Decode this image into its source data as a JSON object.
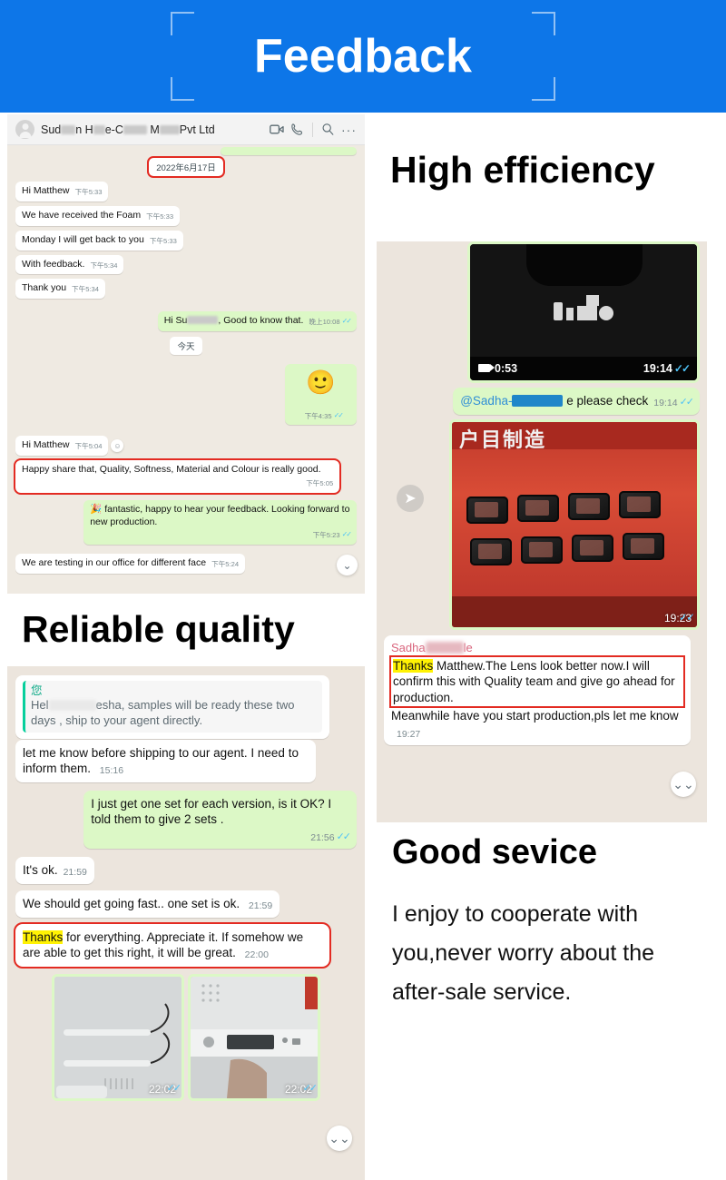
{
  "banner": {
    "title": "Feedback"
  },
  "headings": {
    "high_efficiency": "High efficiency",
    "reliable_quality": "Reliable quality",
    "good_service": "Good sevice"
  },
  "good_service_body": "I enjoy to cooperate with you,never worry about the after-sale service.",
  "chat_desktop": {
    "contact_name_prefix": "Sud",
    "contact_name_mid1": "n H",
    "contact_name_mid2": "e-C",
    "contact_name_mid3": " M",
    "contact_name_suffix": "Pvt Ltd",
    "icons": {
      "video": "video-call-icon",
      "phone": "voice-call-icon",
      "search": "search-icon",
      "more": "more-options-icon"
    },
    "date_chip": "2022年6月17日",
    "today_chip": "今天",
    "messages": [
      {
        "dir": "in",
        "text": "Hi Matthew",
        "time": "下午5:33"
      },
      {
        "dir": "in",
        "text": "We have received the Foam",
        "time": "下午5:33"
      },
      {
        "dir": "in",
        "text": "Monday I will get back to you",
        "time": "下午5:33"
      },
      {
        "dir": "in",
        "text": "With feedback.",
        "time": "下午5:34"
      },
      {
        "dir": "in",
        "text": "Thank you",
        "time": "下午5:34"
      },
      {
        "dir": "out",
        "text_a": "Hi Su",
        "text_b": ", Good to know that.",
        "time": "晚上10:08"
      },
      {
        "dir": "out",
        "emoji": "🙂",
        "time": "下午4:35"
      },
      {
        "dir": "in",
        "text": "Hi Matthew",
        "time": "下午5:04"
      },
      {
        "dir": "in",
        "text": "Happy share that, Quality, Softness, Material and Colour  is really good.",
        "time": "下午5:05",
        "highlight_box": true
      },
      {
        "dir": "out",
        "text": "🎉 fantastic, happy to hear your feedback. Looking forward to new production.",
        "time": "下午5:23"
      },
      {
        "dir": "in",
        "text": "We are testing in our office for different face",
        "time": "下午5:24"
      }
    ]
  },
  "chat_mobile_left": {
    "quote": {
      "name": "您",
      "text_a": "Hel",
      "text_b": "esha, samples will be ready these two days , ship to your agent directly."
    },
    "messages": [
      {
        "dir": "in",
        "text": "let me know before shipping to our agent. I need to inform them.",
        "time": "15:16"
      },
      {
        "dir": "out",
        "text": "I just get one set for each version, is it OK? I told them to give 2 sets .",
        "time": "21:56"
      },
      {
        "dir": "in",
        "text": "It's ok.",
        "time": "21:59"
      },
      {
        "dir": "in",
        "text": "We should get going fast.. one set is ok.",
        "time": "21:59"
      },
      {
        "dir": "in",
        "text_hl": "Thanks",
        "text": " for everything. Appreciate it. If somehow we are able to get this right, it will be great.",
        "time": "22:00",
        "highlight_box": true
      }
    ],
    "media": [
      {
        "name": "photo-wires",
        "time": "22:02"
      },
      {
        "name": "photo-panel",
        "time": "22:02"
      }
    ]
  },
  "chat_mobile_right": {
    "video": {
      "duration": "0:53",
      "time": "19:14"
    },
    "mention": {
      "text_a": "@Sadha-",
      "text_b": " e please check",
      "time": "19:14"
    },
    "photo": {
      "time": "19:23"
    },
    "reply": {
      "sender_a": "Sadha",
      "sender_b": "le",
      "text_hl": "Thanks",
      "text_boxed": " Matthew.The Lens look better now.I will confirm this with Quality team and give go ahead for production.",
      "text_rest": "Meanwhile have you start production,pls let me know",
      "time": "19:27"
    }
  }
}
